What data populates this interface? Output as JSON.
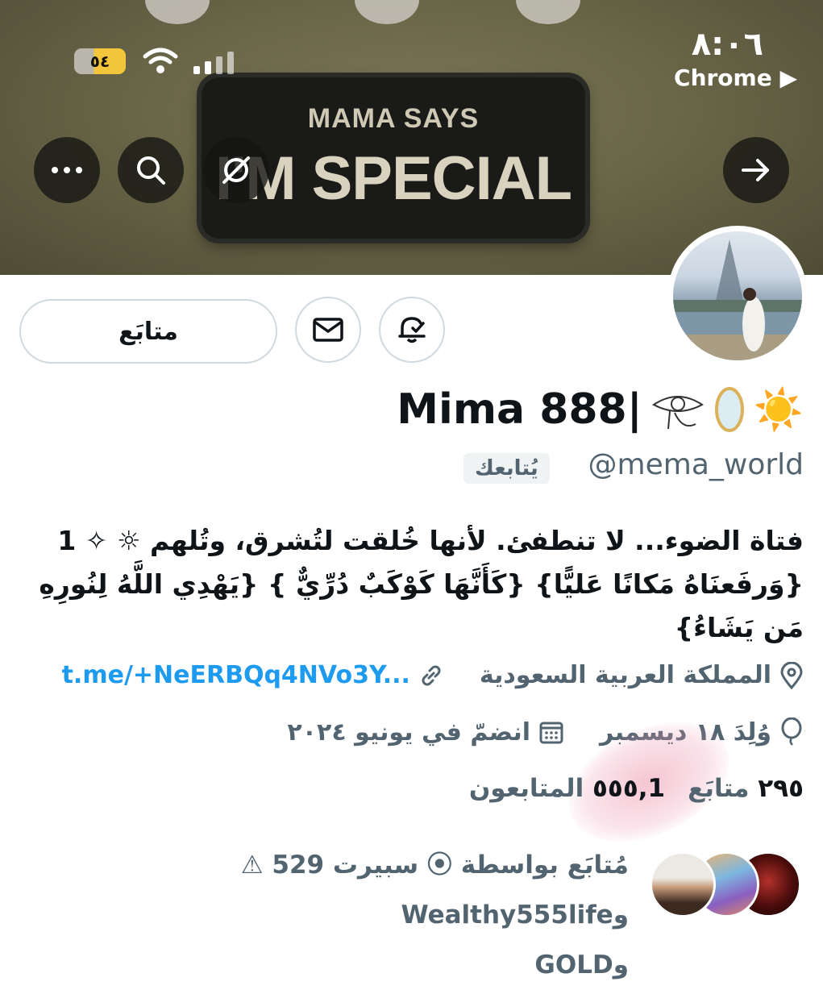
{
  "status_bar": {
    "time": "٨:٠٦",
    "back_app": "Chrome ▶",
    "battery": "٥٤"
  },
  "banner": {
    "patch_line1": "MAMA SAYS",
    "patch_line2": "I'M SPECIAL"
  },
  "header_actions": [
    "more-options",
    "search",
    "grok-ai",
    "back"
  ],
  "profile": {
    "display_name": "Mima 888|",
    "name_emojis": "☀️",
    "handle": "@mema_world",
    "follows_you": "يُتابعك",
    "follow_button": "متابَع",
    "bio_lines": [
      "فتاة الضوء... لا تنطفئ. لأنها خُلقت لتُشرق، وتُلهم ☼ ✧ 1",
      "{وَرفَعنَاهُ مَكانًا عَليًّا} {كَأَنَّهَا كَوْكَبٌ دُرِّيٌّ } {يَهْدِي اللَّهُ لِنُورِهِ",
      "مَن يَشَاءُ}"
    ],
    "location": "المملكة العربية السعودية",
    "link": "t.me/+NeERBQq4NVo3Y...",
    "birthday": "وُلِدَ ١٨ ديسمبر",
    "joined": "انضمّ في يونيو ٢٠٢٤",
    "following_count": "٢٩٥",
    "following_label": "متابَع",
    "followers_count": "1,٥٥٥",
    "followers_label": "المتابعون",
    "followed_by_line1": "مُتابَع بواسطة ⦿ سبيرت 529 ⚠︎ وWealthy555life",
    "followed_by_line2": "وGOLD"
  },
  "colors": {
    "accent_link": "#1d9bf0",
    "secondary_text": "#536471",
    "primary_text": "#0f1419",
    "battery_yellow": "#f3c53a"
  }
}
